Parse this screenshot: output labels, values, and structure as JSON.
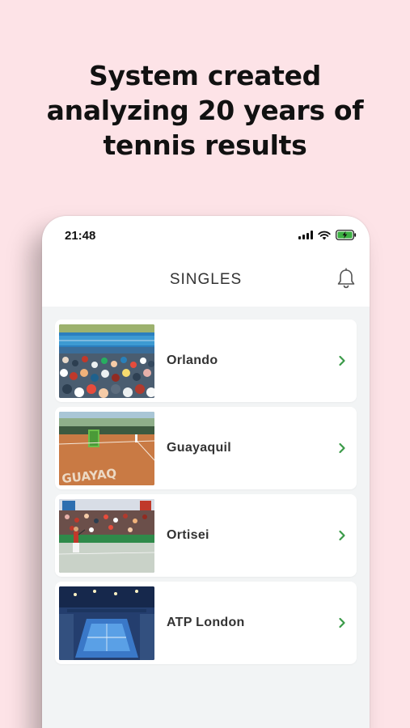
{
  "headline": {
    "line1": "System created",
    "line2": "analyzing 20 years of",
    "line3": "tennis results"
  },
  "status_bar": {
    "time": "21:48",
    "icons": [
      "signal-icon",
      "wifi-icon",
      "battery-charging-icon"
    ]
  },
  "header": {
    "title": "SINGLES",
    "icon": "bell-icon"
  },
  "tournaments": [
    {
      "name": "Orlando",
      "image": "hard-court-crowd-photo"
    },
    {
      "name": "Guayaquil",
      "image": "clay-court-photo"
    },
    {
      "name": "Ortisei",
      "image": "indoor-court-player-photo"
    },
    {
      "name": "ATP London",
      "image": "arena-court-photo"
    }
  ],
  "colors": {
    "background": "#fde3e7",
    "list_background": "#f2f4f5",
    "chevron": "#3a9a48",
    "battery": "#3cb043"
  }
}
